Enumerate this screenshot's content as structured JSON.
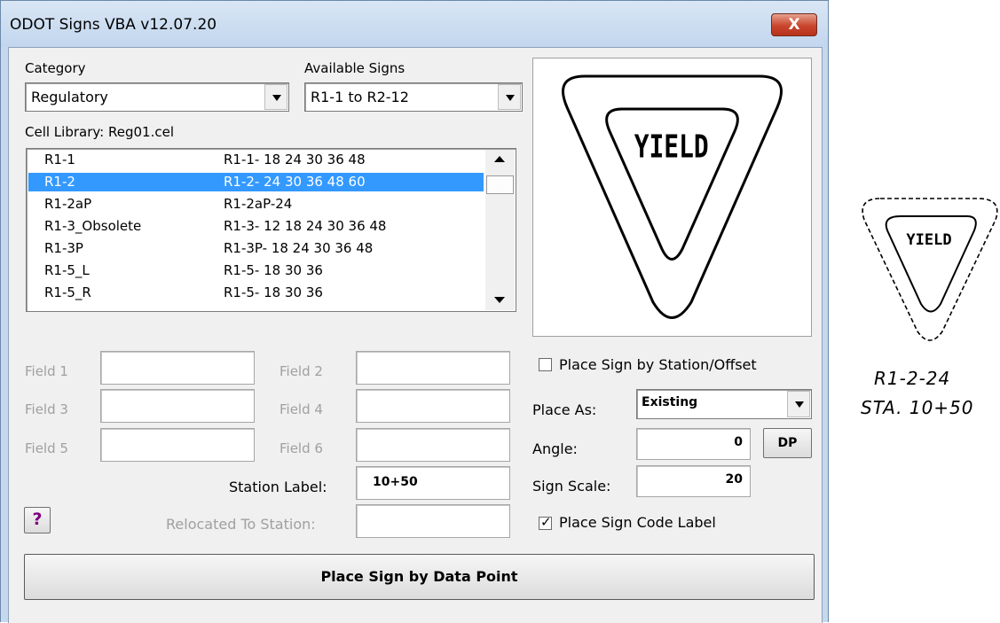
{
  "window": {
    "title": "ODOT Signs VBA  v12.07.20",
    "close_glyph": "X"
  },
  "category": {
    "label": "Category",
    "value": "Regulatory"
  },
  "available_signs": {
    "label": "Available Signs",
    "value": "R1-1 to R2-12"
  },
  "cell_library": {
    "label": "Cell Library:  Reg01.cel"
  },
  "sign_list": {
    "rows": [
      {
        "code": "R1-1",
        "sizes": "R1-1- 18 24 30 36 48",
        "selected": false
      },
      {
        "code": "R1-2",
        "sizes": "R1-2- 24 30 36 48 60",
        "selected": true
      },
      {
        "code": "R1-2aP",
        "sizes": "R1-2aP-24",
        "selected": false
      },
      {
        "code": "R1-3_Obsolete",
        "sizes": "R1-3- 12 18 24 30 36 48",
        "selected": false
      },
      {
        "code": "R1-3P",
        "sizes": "R1-3P- 18 24 30 36 48",
        "selected": false
      },
      {
        "code": "R1-5_L",
        "sizes": "R1-5- 18 30 36",
        "selected": false
      },
      {
        "code": "R1-5_R",
        "sizes": "R1-5- 18 30 36",
        "selected": false
      }
    ]
  },
  "preview": {
    "sign_text": "YIELD"
  },
  "fields": {
    "field1": "Field 1",
    "field2": "Field 2",
    "field3": "Field 3",
    "field4": "Field 4",
    "field5": "Field 5",
    "field6": "Field 6"
  },
  "station_label": {
    "label": "Station Label:",
    "value": "10+50"
  },
  "relocated": {
    "label": "Relocated To Station:",
    "value": ""
  },
  "help_button": {
    "label": "?"
  },
  "station_offset": {
    "label": "Place Sign by Station/Offset",
    "checked": false
  },
  "place_as": {
    "label": "Place As:",
    "value": "Existing"
  },
  "angle": {
    "label": "Angle:",
    "value": "0"
  },
  "dp_button": {
    "label": "DP"
  },
  "sign_scale": {
    "label": "Sign Scale:",
    "value": "20"
  },
  "code_label": {
    "label": "Place Sign Code Label",
    "checked": true,
    "mark": "✓"
  },
  "place_button": {
    "label": "Place Sign by Data Point"
  },
  "drawing": {
    "sign_text": "YIELD",
    "code_label": "R1-2-24",
    "station_label": "STA. 10+50"
  },
  "colors": {
    "selection": "#3399ff",
    "title_bar": "#c5d8ee",
    "close_button": "#c9452c",
    "help_glyph": "#800080"
  }
}
